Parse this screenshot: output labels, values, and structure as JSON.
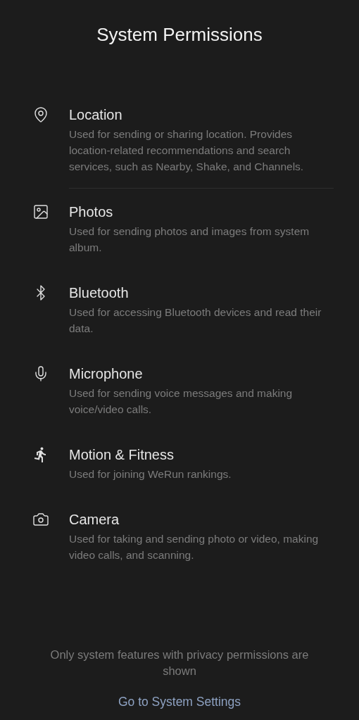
{
  "title": "System Permissions",
  "permissions": [
    {
      "kind": "location",
      "name": "Location",
      "description": "Used for sending or sharing location. Provides location-related recommendations and search services, such as Nearby, Shake, and Channels.",
      "separated": true
    },
    {
      "kind": "photos",
      "name": "Photos",
      "description": "Used for sending photos and images from system album.",
      "separated": false
    },
    {
      "kind": "bluetooth",
      "name": "Bluetooth",
      "description": "Used for accessing Bluetooth devices and read their data.",
      "separated": false
    },
    {
      "kind": "microphone",
      "name": "Microphone",
      "description": "Used for sending voice messages and making voice/video calls.",
      "separated": false
    },
    {
      "kind": "motion",
      "name": "Motion & Fitness",
      "description": "Used for joining WeRun rankings.",
      "separated": false
    },
    {
      "kind": "camera",
      "name": "Camera",
      "description": "Used for taking and sending photo or video, making video calls, and scanning."
    }
  ],
  "footer": {
    "note": "Only system features with privacy permissions are shown",
    "link": "Go to System Settings"
  }
}
